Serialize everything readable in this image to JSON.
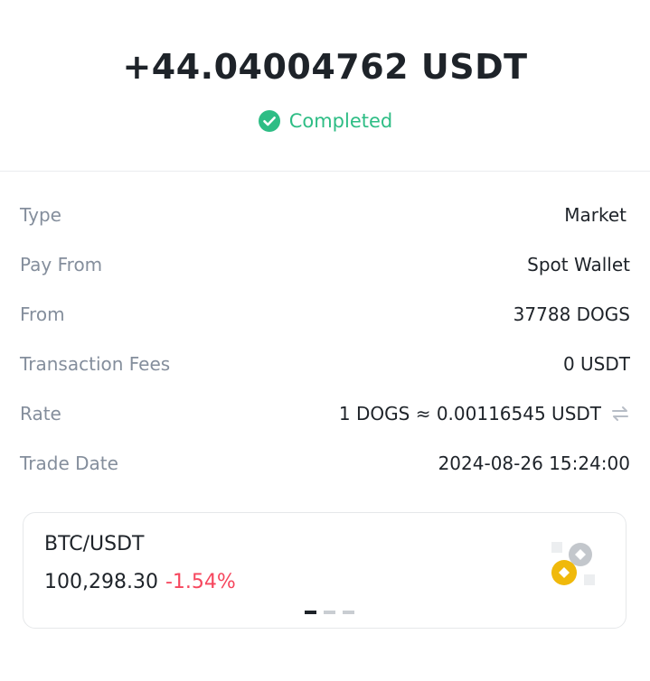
{
  "transaction": {
    "amount": "+44.04004762 USDT",
    "status": "Completed",
    "status_icon": "check-circle-icon",
    "status_color": "#2ebd85"
  },
  "details": [
    {
      "label": "Type",
      "value": "Market"
    },
    {
      "label": "Pay From",
      "value": "Spot Wallet"
    },
    {
      "label": "From",
      "value": "37788 DOGS"
    },
    {
      "label": "Transaction Fees",
      "value": "0 USDT"
    },
    {
      "label": "Rate",
      "value": "1 DOGS ≈ 0.00116545 USDT",
      "icon": "swap-arrows-icon"
    },
    {
      "label": "Trade Date",
      "value": "2024-08-26 15:24:00"
    }
  ],
  "ticker": {
    "pair": "BTC/USDT",
    "price": "100,298.30",
    "change": "-1.54%",
    "change_color": "#f6465d",
    "icon": "coins-icon",
    "carousel_active_index": 0,
    "carousel_count": 3
  }
}
